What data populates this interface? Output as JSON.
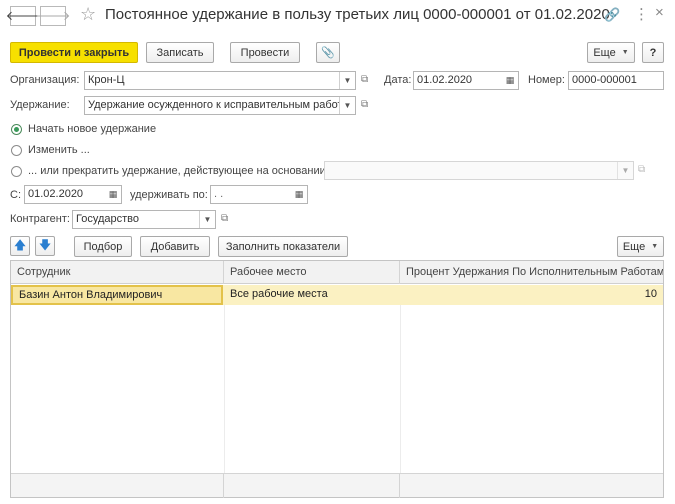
{
  "window": {
    "title": "Постоянное удержание в пользу третьих лиц 0000-000001 от 01.02.2020"
  },
  "nav": {
    "back": "🡐",
    "forward": "🡒",
    "star": "☆",
    "link": "🔗",
    "more": "⋮",
    "close": "×"
  },
  "toolbar": {
    "post_close": "Провести и закрыть",
    "save": "Записать",
    "post": "Провести",
    "attach": "📎",
    "more": "Еще",
    "help": "?"
  },
  "form": {
    "org_label": "Организация:",
    "org_value": "Крон-Ц",
    "date_label": "Дата:",
    "date_value": "01.02.2020",
    "number_label": "Номер:",
    "number_value": "0000-000001",
    "deduction_label": "Удержание:",
    "deduction_value": "Удержание осужденного к исправительным работам",
    "radio_new": "Начать новое удержание",
    "radio_change": "Изменить ...",
    "radio_stop": "... или прекратить удержание, действующее на основании",
    "from_label": "С:",
    "from_value": "01.02.2020",
    "until_label": "удерживать по:",
    "until_value": " .  .",
    "contractor_label": "Контрагент:",
    "contractor_value": "Государство"
  },
  "table_toolbar": {
    "up": "🡅",
    "down": "🡇",
    "select": "Подбор",
    "add": "Добавить",
    "fill": "Заполнить показатели",
    "more": "Еще"
  },
  "table": {
    "columns": [
      "Сотрудник",
      "Рабочее место",
      "Процент Удержания По Исполнительным Работам"
    ],
    "rows": [
      [
        "Базин Антон Владимирович",
        "Все рабочие места",
        "10"
      ]
    ]
  }
}
